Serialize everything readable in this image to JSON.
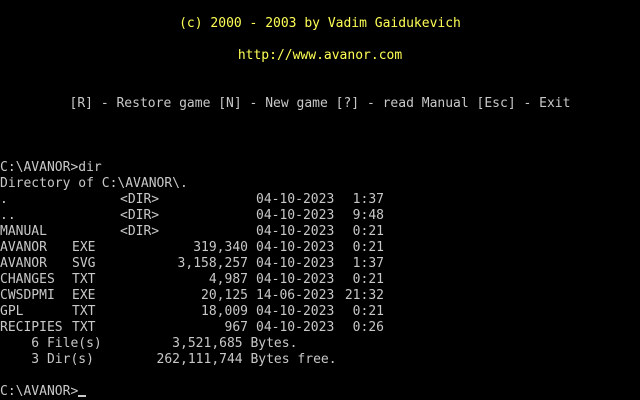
{
  "header": {
    "copyright": "(c) 2000 - 2003 by Vadim Gaidukevich",
    "url": "http://www.avanor.com",
    "menu": {
      "restore_key": "[R]",
      "restore_label": " - Restore game ",
      "new_key": "[N]",
      "new_label": " - New game ",
      "manual_key": "[?]",
      "manual_label": " - read Manual ",
      "exit_key": "[Esc]",
      "exit_label": " - Exit"
    }
  },
  "console": {
    "prompt_command": "C:\\AVANOR>dir",
    "directory_line": "Directory of C:\\AVANOR\\.",
    "entries": [
      {
        "name": ".",
        "ext": "",
        "size": "<DIR>",
        "date": "04-10-2023",
        "time": " 1:37"
      },
      {
        "name": "..",
        "ext": "",
        "size": "<DIR>",
        "date": "04-10-2023",
        "time": " 9:48"
      },
      {
        "name": "MANUAL",
        "ext": "",
        "size": "<DIR>",
        "date": "04-10-2023",
        "time": " 0:21"
      },
      {
        "name": "AVANOR",
        "ext": "EXE",
        "size": "319,340",
        "date": "04-10-2023",
        "time": " 0:21"
      },
      {
        "name": "AVANOR",
        "ext": "SVG",
        "size": "3,158,257",
        "date": "04-10-2023",
        "time": " 1:37"
      },
      {
        "name": "CHANGES",
        "ext": "TXT",
        "size": "4,987",
        "date": "04-10-2023",
        "time": " 0:21"
      },
      {
        "name": "CWSDPMI",
        "ext": "EXE",
        "size": "20,125",
        "date": "14-06-2023",
        "time": "21:32"
      },
      {
        "name": "GPL",
        "ext": "TXT",
        "size": "18,009",
        "date": "04-10-2023",
        "time": " 0:21"
      },
      {
        "name": "RECIPIES",
        "ext": "TXT",
        "size": "967",
        "date": "04-10-2023",
        "time": " 0:26"
      }
    ],
    "summary_files": "    6 File(s)         3,521,685 Bytes.",
    "summary_dirs": "    3 Dir(s)        262,111,744 Bytes free.",
    "current_prompt": "C:\\AVANOR>"
  }
}
